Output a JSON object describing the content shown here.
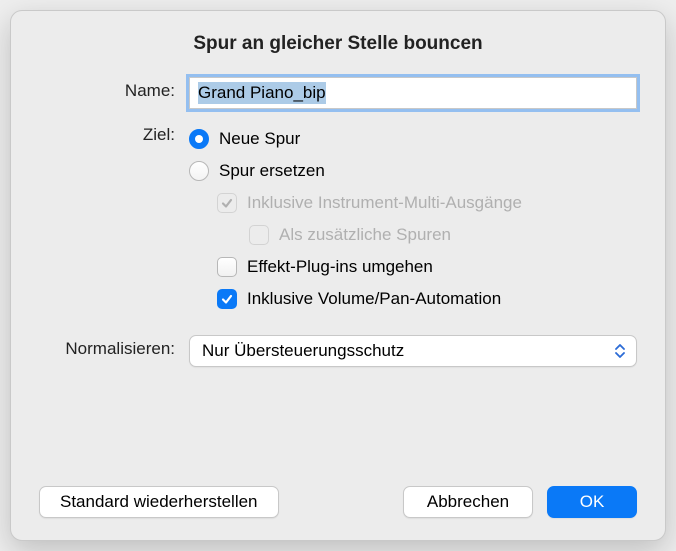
{
  "title": "Spur an gleicher Stelle bouncen",
  "name": {
    "label": "Name:",
    "value": "Grand Piano_bip"
  },
  "destination": {
    "label": "Ziel:",
    "options": {
      "new_track": {
        "label": "Neue Spur",
        "selected": true
      },
      "replace_track": {
        "label": "Spur ersetzen",
        "selected": false
      },
      "include_multi": {
        "label": "Inklusive Instrument-Multi-Ausgänge",
        "checked": true,
        "enabled": false
      },
      "as_additional": {
        "label": "Als zusätzliche Spuren",
        "checked": false,
        "enabled": false
      },
      "bypass_fx": {
        "label": "Effekt-Plug-ins umgehen",
        "checked": false,
        "enabled": true
      },
      "include_volpan": {
        "label": "Inklusive Volume/Pan-Automation",
        "checked": true,
        "enabled": true
      }
    }
  },
  "normalize": {
    "label": "Normalisieren:",
    "value": "Nur Übersteuerungsschutz"
  },
  "buttons": {
    "restore_default": "Standard wiederherstellen",
    "cancel": "Abbrechen",
    "ok": "OK"
  }
}
